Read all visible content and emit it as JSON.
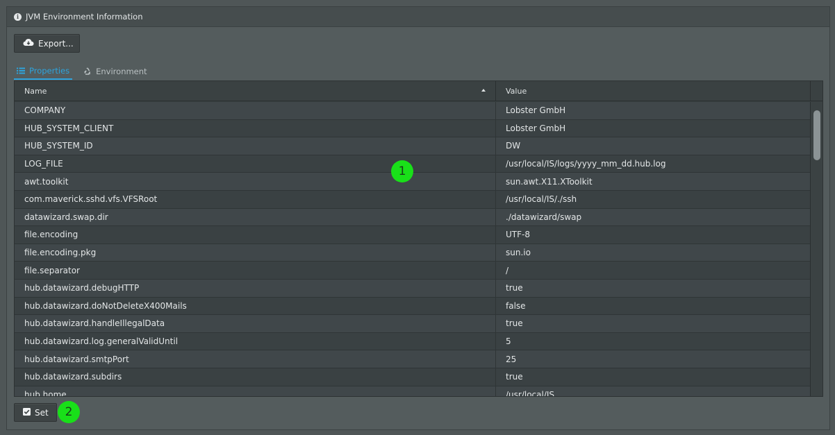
{
  "window": {
    "title": "JVM Environment Information"
  },
  "toolbar": {
    "export_label": "Export..."
  },
  "tabs": [
    {
      "label": "Properties",
      "icon": "list-icon",
      "active": true
    },
    {
      "label": "Environment",
      "icon": "recycle-icon",
      "active": false
    }
  ],
  "table": {
    "columns": [
      {
        "label": "Name",
        "sorted": "ascending"
      },
      {
        "label": "Value"
      }
    ],
    "rows": [
      {
        "name": "COMPANY",
        "value": "Lobster GmbH"
      },
      {
        "name": "HUB_SYSTEM_CLIENT",
        "value": "Lobster GmbH"
      },
      {
        "name": "HUB_SYSTEM_ID",
        "value": "DW"
      },
      {
        "name": "LOG_FILE",
        "value": "/usr/local/IS/logs/yyyy_mm_dd.hub.log"
      },
      {
        "name": "awt.toolkit",
        "value": "sun.awt.X11.XToolkit"
      },
      {
        "name": "com.maverick.sshd.vfs.VFSRoot",
        "value": "/usr/local/IS/./ssh"
      },
      {
        "name": "datawizard.swap.dir",
        "value": "./datawizard/swap"
      },
      {
        "name": "file.encoding",
        "value": "UTF-8"
      },
      {
        "name": "file.encoding.pkg",
        "value": "sun.io"
      },
      {
        "name": "file.separator",
        "value": "/"
      },
      {
        "name": "hub.datawizard.debugHTTP",
        "value": "true"
      },
      {
        "name": "hub.datawizard.doNotDeleteX400Mails",
        "value": "false"
      },
      {
        "name": "hub.datawizard.handleIllegalData",
        "value": "true"
      },
      {
        "name": "hub.datawizard.log.generalValidUntil",
        "value": "5"
      },
      {
        "name": "hub.datawizard.smtpPort",
        "value": "25"
      },
      {
        "name": "hub.datawizard.subdirs",
        "value": "true"
      },
      {
        "name": "hub.home",
        "value": "/usr/local/IS"
      }
    ]
  },
  "footer": {
    "set_label": "Set"
  },
  "annotations": {
    "badge1": "1",
    "badge2": "2"
  },
  "colors": {
    "accent": "#2ea3dc",
    "badge": "#19e019"
  }
}
